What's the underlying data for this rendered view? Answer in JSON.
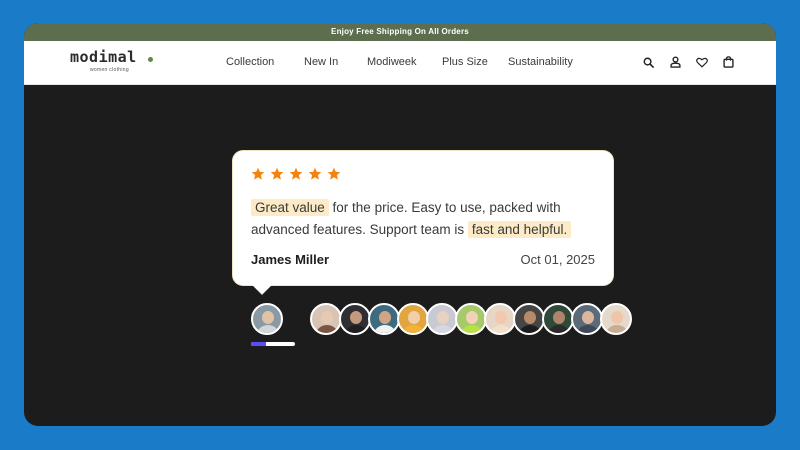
{
  "promo_bar": {
    "text": "Enjoy Free Shipping On All Orders"
  },
  "brand": {
    "name": "modimal",
    "tagline": "women clothing",
    "accent": "#5e8a45"
  },
  "nav": {
    "items": [
      {
        "label": "Collection"
      },
      {
        "label": "New In"
      },
      {
        "label": "Modiweek"
      },
      {
        "label": "Plus Size"
      },
      {
        "label": "Sustainability"
      }
    ],
    "icons": [
      "search-icon",
      "user-icon",
      "heart-icon",
      "bag-icon"
    ]
  },
  "review": {
    "rating": 5,
    "max_rating": 5,
    "star_color": "#f5820c",
    "text_before": "Great value",
    "text_mid": " for the price. Easy to use, packed with advanced features. Support team is ",
    "text_highlight": "fast and helpful.",
    "author": "James Miller",
    "date": "Oct 01, 2025",
    "highlight_color": "#fcebc6"
  },
  "carousel": {
    "progress": 0.35,
    "progress_color": "#5b4df5",
    "avatar_count": 11
  },
  "colors": {
    "page_bg": "#1a7cc9",
    "promo_bg": "#5c6e4d",
    "hero_bg": "#1c1c1c"
  }
}
